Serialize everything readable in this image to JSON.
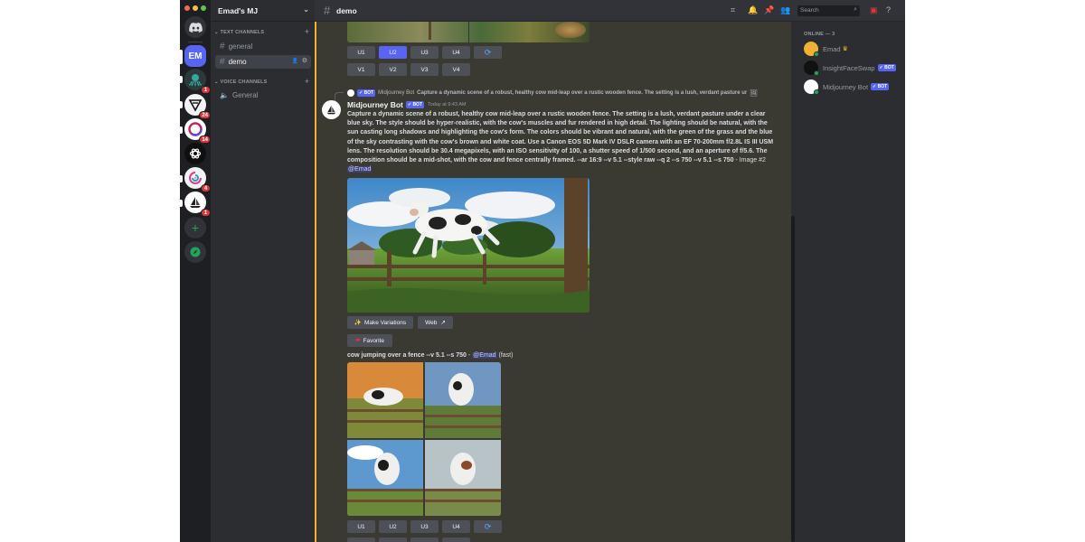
{
  "window": {
    "traffic_lights": [
      "#ed6a5e",
      "#f5bf4f",
      "#61c554"
    ]
  },
  "servers": [
    {
      "name": "discord-home",
      "label": "",
      "badge": ""
    },
    {
      "name": "emad-mj",
      "label": "EM",
      "badge": ""
    },
    {
      "name": "server-tentacle",
      "label": "",
      "badge": "1"
    },
    {
      "name": "server-triangle",
      "label": "",
      "badge": "24"
    },
    {
      "name": "server-ring",
      "label": "",
      "badge": "14"
    },
    {
      "name": "server-openai",
      "label": "",
      "badge": ""
    },
    {
      "name": "server-swirl",
      "label": "",
      "badge": "4"
    },
    {
      "name": "server-boat",
      "label": "",
      "badge": "1"
    }
  ],
  "sidebar": {
    "server_name": "Emad's MJ",
    "text_category": "TEXT CHANNELS",
    "voice_category": "VOICE CHANNELS",
    "text_channels": [
      {
        "name": "general",
        "selected": false
      },
      {
        "name": "demo",
        "selected": true
      }
    ],
    "voice_channels": [
      {
        "name": "General"
      }
    ]
  },
  "header": {
    "channel": "demo",
    "search_placeholder": "Search"
  },
  "members": {
    "heading": "ONLINE — 3",
    "list": [
      {
        "name": "Emad",
        "bot": false,
        "crown": true
      },
      {
        "name": "InsightFaceSwap",
        "bot": true,
        "crown": false
      },
      {
        "name": "Midjourney Bot",
        "bot": true,
        "crown": false
      }
    ],
    "bot_label": "✓ BOT"
  },
  "upscale_buttons": [
    "U1",
    "U2",
    "U3",
    "U4"
  ],
  "variation_buttons": [
    "V1",
    "V2",
    "V3",
    "V4"
  ],
  "message": {
    "reply_author": "Midjourney Bot",
    "reply_bot": "✓ BOT",
    "reply_text": "Capture a dynamic scene of a robust, healthy cow mid-leap over a rustic wooden fence. The setting is a lush, verdant pasture ur",
    "author": "Midjourney Bot",
    "bot_tag": "✓ BOT",
    "timestamp": "Today at 9:43 AM",
    "body": "Capture a dynamic scene of a robust, healthy cow mid-leap over a rustic wooden fence. The setting is a lush, verdant pasture under a clear blue sky. The style should be hyper-realistic, with the cow's muscles and fur rendered in high detail. The lighting should be natural, with the sun casting long shadows and highlighting the cow's form. The colors should be vibrant and natural, with the green of the grass and the blue of the sky contrasting with the cow's brown and white coat. Use a Canon EOS 5D Mark IV DSLR camera with an EF 70-200mm f/2.8L IS III USM lens. The resolution should be 30.4 megapixels, with an ISO sensitivity of 100, a shutter speed of 1/500 second, and an aperture of f/5.6. The composition should be a mid-shot, with the cow and fence centrally framed. --ar 16:9 --v 5.1 --style raw --q 2 --s 750 --v 5.1 --s 750",
    "body_suffix": " - Image #2 ",
    "mention": "@Emad",
    "make_variations": "Make Variations",
    "web": "Web",
    "favorite": "Favorite"
  },
  "second_message": {
    "prompt": "cow jumping over a fence --v 5.1 --s 750",
    "dash": " - ",
    "mention": "@Emad",
    "mode": "(fast)"
  }
}
